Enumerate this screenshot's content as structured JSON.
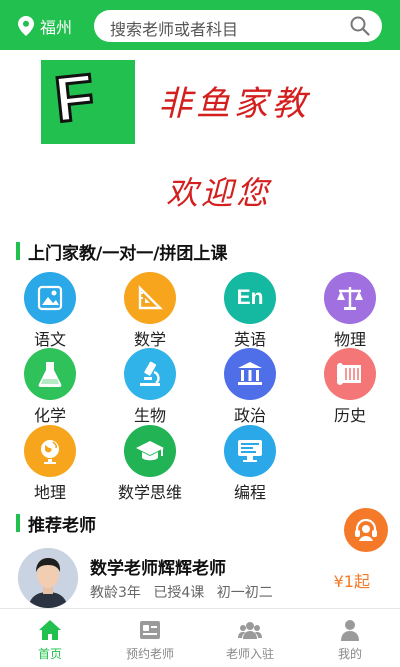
{
  "header": {
    "city": "福州",
    "search_placeholder": "搜索老师或者科目"
  },
  "brand": {
    "logo_letter": "F",
    "name": "非鱼家教",
    "welcome": "欢迎您"
  },
  "sections": {
    "subjects_title": "上门家教/一对一/拼团上课",
    "teachers_title": "推荐老师"
  },
  "subjects": [
    {
      "label": "语文",
      "icon": "picture-book-icon",
      "color": "#2aa8e8"
    },
    {
      "label": "数学",
      "icon": "ruler-triangle-icon",
      "color": "#f7a51c"
    },
    {
      "label": "英语",
      "icon": "en-text-icon",
      "color": "#15b8a0",
      "icon_text": "En"
    },
    {
      "label": "物理",
      "icon": "balance-scale-icon",
      "color": "#a070e0"
    },
    {
      "label": "化学",
      "icon": "flask-icon",
      "color": "#2fc25b"
    },
    {
      "label": "生物",
      "icon": "microscope-icon",
      "color": "#2fb3e8"
    },
    {
      "label": "政治",
      "icon": "government-building-icon",
      "color": "#4f6fe8"
    },
    {
      "label": "历史",
      "icon": "scroll-icon",
      "color": "#f47676"
    },
    {
      "label": "地理",
      "icon": "globe-icon",
      "color": "#f7a51c"
    },
    {
      "label": "数学思维",
      "icon": "graduation-cap-icon",
      "color": "#22b355"
    },
    {
      "label": "编程",
      "icon": "computer-screen-icon",
      "color": "#2aa8e8"
    }
  ],
  "teacher": {
    "name": "数学老师辉辉老师",
    "experience": "教龄3年",
    "lessons": "已授4课",
    "grades": "初一初二",
    "price": "¥1起"
  },
  "tabs": [
    {
      "label": "首页",
      "icon": "home-icon",
      "active": true
    },
    {
      "label": "预约老师",
      "icon": "appointment-icon",
      "active": false
    },
    {
      "label": "老师入驻",
      "icon": "teachers-group-icon",
      "active": false
    },
    {
      "label": "我的",
      "icon": "user-icon",
      "active": false
    }
  ],
  "colors": {
    "brand_green": "#22c04e",
    "brand_red": "#d41f1f",
    "price_orange": "#f47a2a"
  }
}
